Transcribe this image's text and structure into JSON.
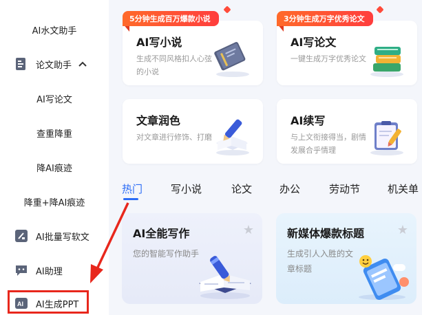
{
  "sidebar": {
    "items": [
      {
        "label": "AI水文助手"
      },
      {
        "label": "论文助手",
        "expanded": true
      },
      {
        "label": "AI写论文"
      },
      {
        "label": "查重降重"
      },
      {
        "label": "降AI痕迹"
      },
      {
        "label": "降重+降AI痕迹"
      },
      {
        "label": "AI批量写软文"
      },
      {
        "label": "AI助理"
      },
      {
        "label": "AI生成PPT"
      }
    ]
  },
  "top_cards": [
    {
      "title": "AI写小说",
      "desc": "生成不同风格扣人心弦的小说",
      "badge": "5分钟生成百万爆款小说",
      "icon": "book-icon"
    },
    {
      "title": "AI写论文",
      "desc": "一键生成万字优秀论文",
      "badge": "3分钟生成万字优秀论文",
      "icon": "books-stack-icon"
    },
    {
      "title": "文章润色",
      "desc": "对文章进行修饰、打磨",
      "icon": "writing-pen-icon"
    },
    {
      "title": "AI续写",
      "desc": "与上文衔接得当，剧情发展合乎情理",
      "icon": "clipboard-pen-icon"
    }
  ],
  "tabs": [
    "热门",
    "写小说",
    "论文",
    "办公",
    "劳动节",
    "机关单"
  ],
  "active_tab": "热门",
  "feature_cards": [
    {
      "title": "AI全能写作",
      "desc": "您的智能写作助手",
      "icon": "open-book-pen-icon"
    },
    {
      "title": "新媒体爆款标题",
      "desc": "生成引人入胜的文章标题",
      "icon": "phone-emoji-icon"
    }
  ],
  "colors": {
    "accent": "#2b6cf6",
    "badge": "#ff4b2b",
    "annotation": "#e8271c"
  }
}
